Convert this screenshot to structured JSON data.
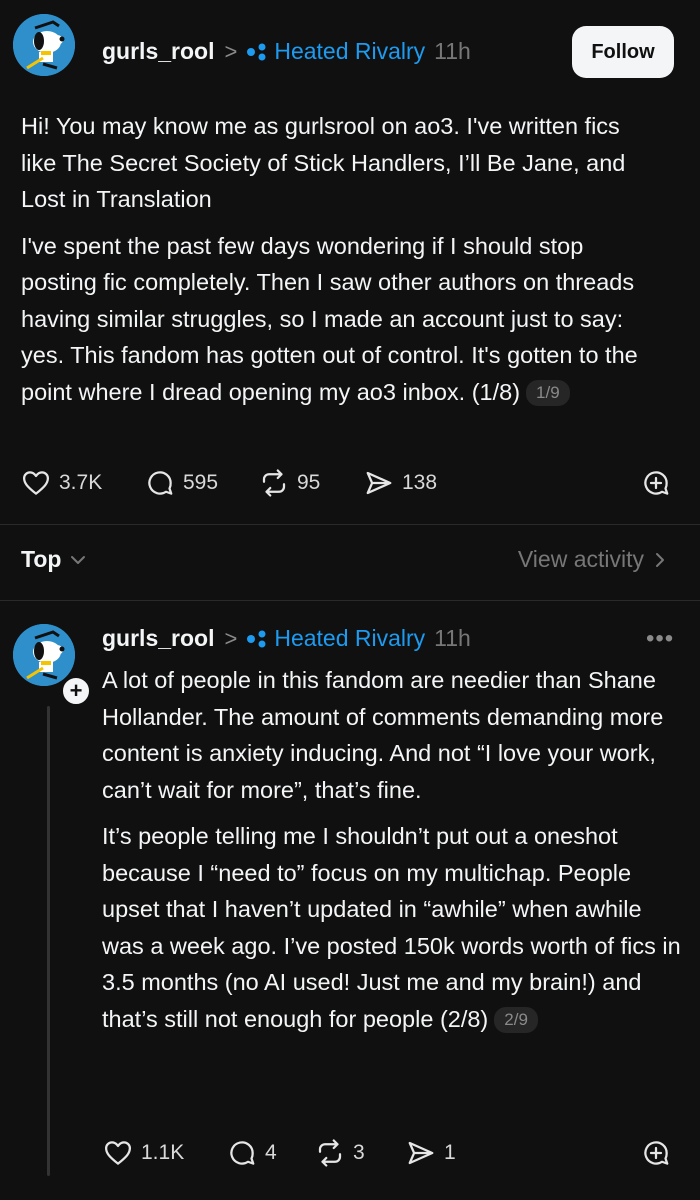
{
  "post": {
    "username": "gurls_rool",
    "separator": ">",
    "community": "Heated Rivalry",
    "time": "11h",
    "follow_label": "Follow",
    "paragraph1": "Hi! You may know me as gurlsrool on ao3. I've written fics like The Secret Society of Stick Handlers, I’ll Be Jane, and Lost in Translation",
    "paragraph2": "I've spent the past few days wondering if I should stop posting fic completely. Then I saw other authors on threads having similar struggles, so I made an account just to say: yes. This fandom has gotten out of control. It's gotten to the point where I dread opening my ao3 inbox. (1/8)",
    "page_badge": "1/9",
    "likes": "3.7K",
    "replies": "595",
    "reposts": "95",
    "shares": "138"
  },
  "sort_bar": {
    "label": "Top",
    "view_activity": "View activity"
  },
  "reply": {
    "username": "gurls_rool",
    "separator": ">",
    "community": "Heated Rivalry",
    "time": "11h",
    "more": "•••",
    "paragraph1": "A lot of people in this fandom are needier than Shane Hollander. The amount of comments demanding more content is anxiety inducing. And not “I love your work, can’t wait for more”, that’s fine.",
    "paragraph2": "It’s people telling me I shouldn’t put out a oneshot because I “need to” focus on my multichap. People upset that I haven’t updated in “awhile” when awhile was a week ago. I’ve posted 150k words worth of fics in 3.5 months (no AI used! Just me and my brain!) and that’s still not enough for people (2/8)",
    "page_badge": "2/9",
    "likes": "1.1K",
    "replies": "4",
    "reposts": "3",
    "shares": "1"
  },
  "colors": {
    "background": "#101010",
    "text": "#f3f5f7",
    "muted": "#777777",
    "community_blue": "#1d9bf0",
    "avatar_bg": "#2f8fcb"
  },
  "icons": {
    "like": "heart-icon",
    "reply": "speech-bubble-icon",
    "repost": "repost-icon",
    "share": "send-icon",
    "quote": "quote-plus-icon"
  }
}
